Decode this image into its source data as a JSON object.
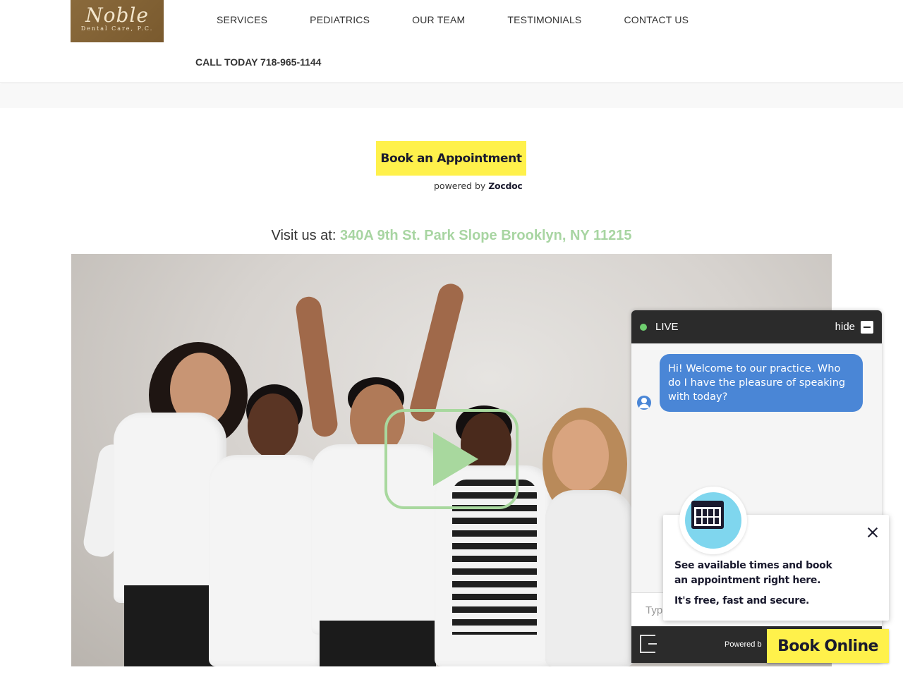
{
  "header": {
    "logo": {
      "name": "Noble",
      "tagline": "Dental Care, P.C."
    },
    "nav": [
      "SERVICES",
      "PEDIATRICS",
      "OUR TEAM",
      "TESTIMONIALS",
      "CONTACT US"
    ],
    "call": "CALL TODAY 718-965-1144"
  },
  "booking": {
    "button_label": "Book an Appointment",
    "powered_prefix": "powered by",
    "powered_brand": "Zocdoc",
    "button_color": "#fff14b"
  },
  "visit": {
    "prefix": "Visit us at:",
    "address": "340A 9th St. Park Slope Brooklyn, NY 11215",
    "address_color": "#a8d5a2"
  },
  "video": {
    "play_icon": "play-icon"
  },
  "chat": {
    "status": "LIVE",
    "hide_label": "hide",
    "message": "Hi! Welcome to our practice.  Who do I have the pleasure of speaking with today?",
    "input_placeholder": "Typ",
    "powered_by": "Powered b",
    "bubble_color": "#4a86d6"
  },
  "zocdoc_popup": {
    "line1": "See available times and book",
    "line2": "an appointment right here.",
    "line3": "It's free, fast and secure.",
    "button_label": "Book Online"
  }
}
